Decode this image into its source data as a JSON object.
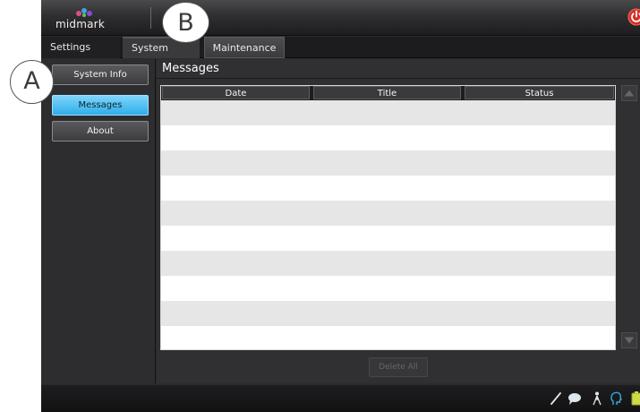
{
  "header": {
    "logo_text": "midmark",
    "power_icon": "power-icon"
  },
  "tabs": [
    {
      "label": "Settings"
    },
    {
      "label": "System"
    },
    {
      "label": "Maintenance"
    }
  ],
  "sidebar": {
    "items": [
      {
        "label": "System Info"
      },
      {
        "label": "Messages"
      },
      {
        "label": "About"
      }
    ],
    "selected": "Messages"
  },
  "main": {
    "title": "Messages",
    "columns": [
      "Date",
      "Title",
      "Status"
    ],
    "rows": [],
    "delete_all_label": "Delete All"
  },
  "status_bar": {
    "icons": [
      "pen-icon",
      "chat-icon",
      "person-icon",
      "head-icon",
      "battery-icon"
    ]
  },
  "callouts": {
    "a": "A",
    "b": "B"
  },
  "colors": {
    "accent": "#2eaee9",
    "power": "#e0342c"
  }
}
